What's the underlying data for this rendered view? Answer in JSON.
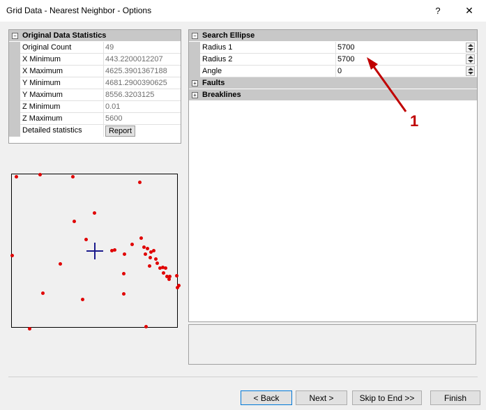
{
  "window": {
    "title": "Grid Data - Nearest Neighbor - Options",
    "help": "?",
    "close": "✕"
  },
  "stats": {
    "header": "Original Data Statistics",
    "toggle": "−",
    "rows": [
      {
        "name": "Original Count",
        "value": "49"
      },
      {
        "name": "X Minimum",
        "value": "443.2200012207"
      },
      {
        "name": "X Maximum",
        "value": "4625.3901367188"
      },
      {
        "name": "Y Minimum",
        "value": "4681.2900390625"
      },
      {
        "name": "Y Maximum",
        "value": "8556.3203125"
      },
      {
        "name": "Z Minimum",
        "value": "0.01"
      },
      {
        "name": "Z Maximum",
        "value": "5600"
      },
      {
        "name": "Detailed statistics",
        "value": ""
      }
    ],
    "report_label": "Report"
  },
  "options": {
    "search_ellipse": {
      "header": "Search Ellipse",
      "toggle": "−",
      "rows": [
        {
          "name": "Radius 1",
          "value": "5700"
        },
        {
          "name": "Radius 2",
          "value": "5700"
        },
        {
          "name": "Angle",
          "value": "0"
        }
      ]
    },
    "faults": {
      "header": "Faults",
      "toggle": "+"
    },
    "breaklines": {
      "header": "Breaklines",
      "toggle": "+"
    }
  },
  "buttons": {
    "back": "< Back",
    "next": "Next >",
    "skip": "Skip to End >>",
    "finish": "Finish"
  },
  "annotation": {
    "number": "1"
  },
  "colors": {
    "point": "#e00000",
    "crosshair": "#1a1a8c",
    "annotation": "#c00000"
  }
}
